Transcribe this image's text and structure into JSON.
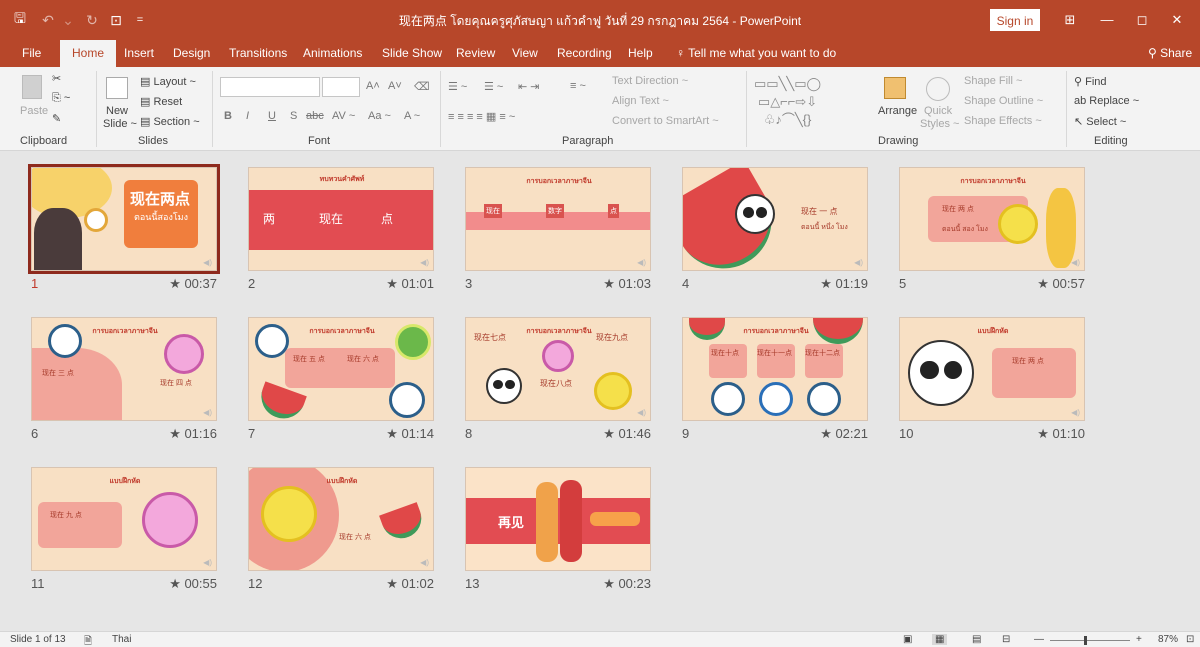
{
  "window": {
    "title": "现在两点 โดยคุณครูศุภัสษญา แก้วคำฟู วันที่ 29 กรกฎาคม 2564  -  PowerPoint",
    "sign_in": "Sign in",
    "minimize": "—",
    "restore": "◻",
    "close": "✕"
  },
  "menu": {
    "tabs": [
      "File",
      "Home",
      "Insert",
      "Design",
      "Transitions",
      "Animations",
      "Slide Show",
      "Review",
      "View",
      "Recording",
      "Help"
    ],
    "active_tab": "Home",
    "tell_me": "Tell me what you want to do",
    "share": "Share"
  },
  "ribbon": {
    "clipboard": {
      "paste": "Paste",
      "group": "Clipboard"
    },
    "slides": {
      "new_slide": "New",
      "new_slide2": "Slide ~",
      "layout": "Layout ~",
      "reset": "Reset",
      "section": "Section ~",
      "group": "Slides"
    },
    "font": {
      "group": "Font",
      "bold": "B",
      "italic": "I",
      "underline": "U",
      "shadow": "S",
      "strike": "abc",
      "spacing": "AV ~",
      "case": "Aa ~",
      "color": "A ~",
      "grow": "A˄",
      "shrink": "A˅"
    },
    "paragraph": {
      "group": "Paragraph",
      "text_direction": "Text Direction ~",
      "align_text": "Align Text ~",
      "smartart": "Convert to SmartArt ~"
    },
    "drawing": {
      "group": "Drawing",
      "arrange": "Arrange",
      "quick_styles": "Quick",
      "quick_styles2": "Styles ~",
      "shape_fill": "Shape Fill ~",
      "shape_outline": "Shape Outline ~",
      "shape_effects": "Shape Effects ~"
    },
    "editing": {
      "group": "Editing",
      "find": "Find",
      "replace": "Replace ~",
      "select": "Select ~"
    }
  },
  "slides": [
    {
      "num": "1",
      "time": "★ 00:37",
      "selected": true,
      "title": "现在两点",
      "subtitle": "ตอนนี้สองโมง"
    },
    {
      "num": "2",
      "time": "★ 01:01",
      "title": "ทบทวนคำศัพท์",
      "labels": [
        "两",
        "现在",
        "点"
      ]
    },
    {
      "num": "3",
      "time": "★ 01:03",
      "title": "การบอกเวลาภาษาจีน",
      "labels": [
        "现在",
        "数字",
        "点"
      ]
    },
    {
      "num": "4",
      "time": "★ 01:19",
      "labels": [
        "现在 一 点",
        "ตอนนี้ หนึ่ง โมง"
      ]
    },
    {
      "num": "5",
      "time": "★ 00:57",
      "title": "การบอกเวลาภาษาจีน",
      "labels": [
        "现在 两 点",
        "ตอนนี้ สอง โมง"
      ]
    },
    {
      "num": "6",
      "time": "★ 01:16",
      "title": "การบอกเวลาภาษาจีน",
      "labels": [
        "现在 三 点",
        "现在 四 点"
      ]
    },
    {
      "num": "7",
      "time": "★ 01:14",
      "title": "การบอกเวลาภาษาจีน",
      "labels": [
        "现在 五 点",
        "现在 六 点"
      ]
    },
    {
      "num": "8",
      "time": "★ 01:46",
      "title": "การบอกเวลาภาษาจีน",
      "labels": [
        "现在七点",
        "现在九点",
        "现在八点"
      ]
    },
    {
      "num": "9",
      "time": "★ 02:21",
      "title": "การบอกเวลาภาษาจีน",
      "labels": [
        "现在十点",
        "现在十一点",
        "现在十二点"
      ]
    },
    {
      "num": "10",
      "time": "★ 01:10",
      "title": "แบบฝึกหัด",
      "labels": [
        "现在 两 点"
      ]
    },
    {
      "num": "11",
      "time": "★ 00:55",
      "title": "แบบฝึกหัด",
      "labels": [
        "现在 九 点"
      ]
    },
    {
      "num": "12",
      "time": "★ 01:02",
      "title": "แบบฝึกหัด",
      "labels": [
        "现在 六 点"
      ]
    },
    {
      "num": "13",
      "time": "★ 00:23",
      "labels": [
        "再见"
      ]
    }
  ],
  "status": {
    "slide_of": "Slide 1 of 13",
    "language": "Thai",
    "zoom": "87%",
    "zoom_minus": "—",
    "zoom_plus": "+"
  },
  "colors": {
    "accent": "#b7472a",
    "ribbon": "#f3f3f3",
    "canvas": "#e6e6e6"
  }
}
